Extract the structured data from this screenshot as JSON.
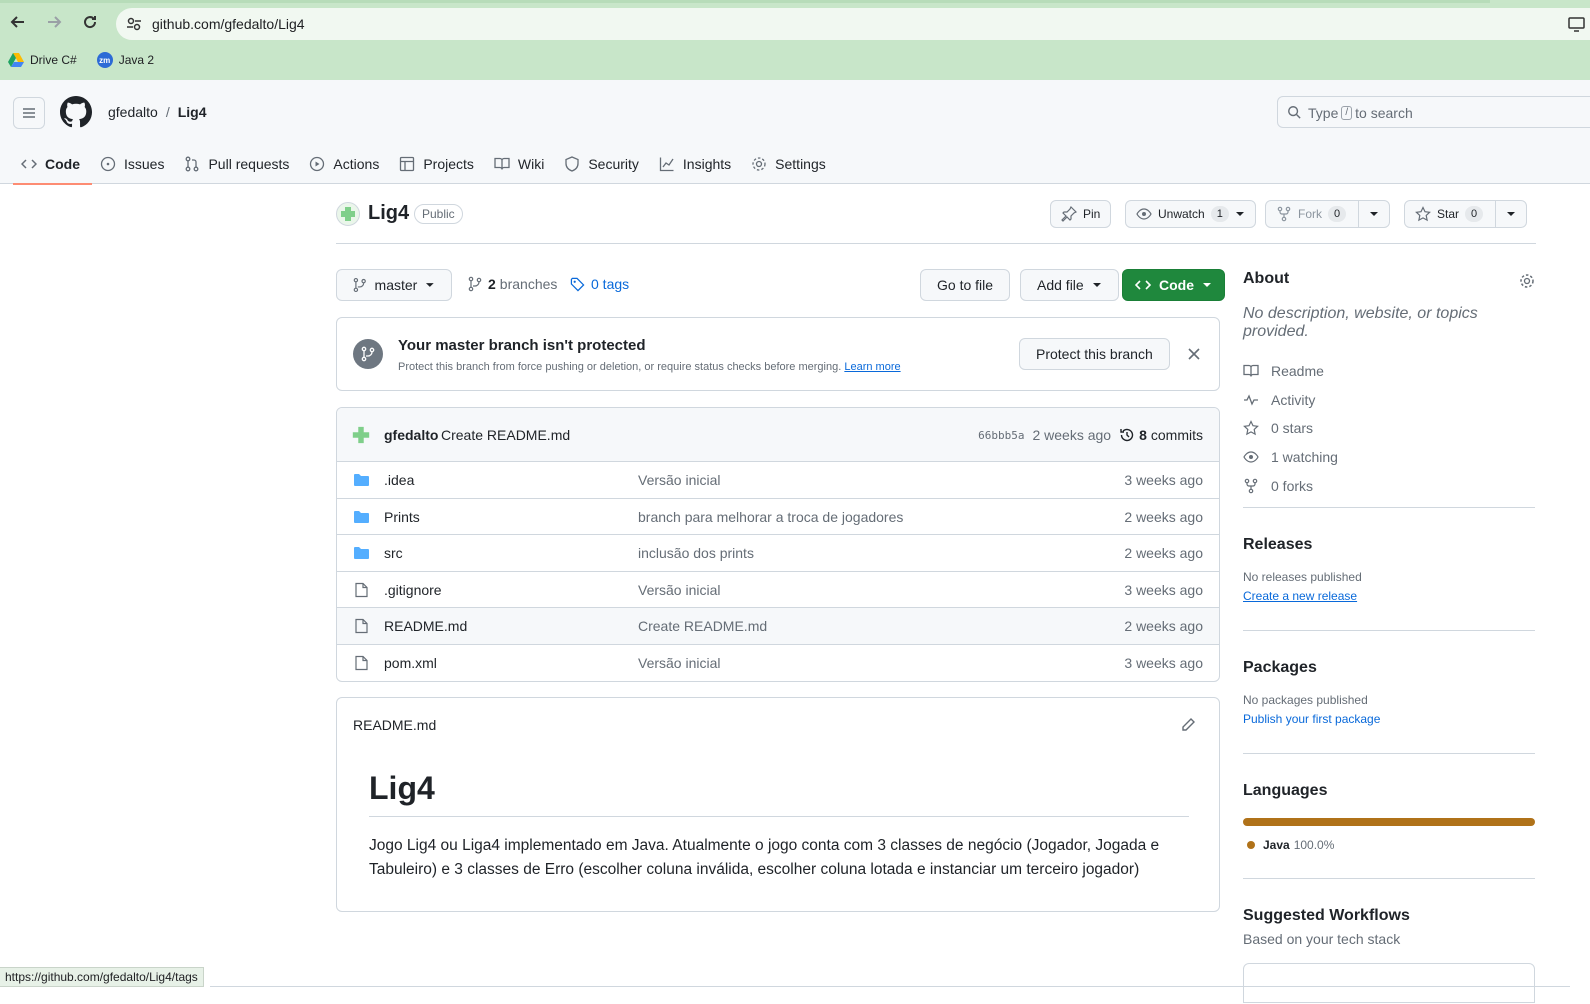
{
  "browser": {
    "url": "github.com/gfedalto/Lig4",
    "bookmarks": [
      {
        "label": "Drive C#"
      },
      {
        "label": "Java 2",
        "badge": "zm"
      }
    ],
    "status_url": "https://github.com/gfedalto/Lig4/tags"
  },
  "header": {
    "owner": "gfedalto",
    "separator": "/",
    "repo": "Lig4",
    "search_placeholder_pre": "Type",
    "search_key": "/",
    "search_placeholder_post": "to search",
    "tabs": [
      {
        "label": "Code",
        "icon": "code-icon",
        "active": true
      },
      {
        "label": "Issues",
        "icon": "issue-icon"
      },
      {
        "label": "Pull requests",
        "icon": "pull-request-icon"
      },
      {
        "label": "Actions",
        "icon": "play-icon"
      },
      {
        "label": "Projects",
        "icon": "table-icon"
      },
      {
        "label": "Wiki",
        "icon": "book-icon"
      },
      {
        "label": "Security",
        "icon": "shield-icon"
      },
      {
        "label": "Insights",
        "icon": "graph-icon"
      },
      {
        "label": "Settings",
        "icon": "gear-icon"
      }
    ]
  },
  "repo": {
    "name": "Lig4",
    "visibility": "Public",
    "pin": "Pin",
    "unwatch": "Unwatch",
    "watch_count": "1",
    "fork": "Fork",
    "fork_count": "0",
    "star": "Star",
    "star_count": "0"
  },
  "controls": {
    "branch": "master",
    "branches_count": "2",
    "branches_label": "branches",
    "tags_label": "0 tags",
    "go_to_file": "Go to file",
    "add_file": "Add file",
    "code": "Code"
  },
  "protect": {
    "title": "Your master branch isn't protected",
    "desc": "Protect this branch from force pushing or deletion, or require status checks before merging.",
    "learn_more": "Learn more",
    "button": "Protect this branch"
  },
  "commit": {
    "author": "gfedalto",
    "message": "Create README.md",
    "sha": "66bbb5a",
    "time": "2 weeks ago",
    "commits_count": "8",
    "commits_label": "commits"
  },
  "files": [
    {
      "name": ".idea",
      "type": "folder",
      "message": "Versão inicial",
      "age": "3 weeks ago"
    },
    {
      "name": "Prints",
      "type": "folder",
      "message": "branch para melhorar a troca de jogadores",
      "age": "2 weeks ago"
    },
    {
      "name": "src",
      "type": "folder",
      "message": "inclusão dos prints",
      "age": "2 weeks ago"
    },
    {
      "name": ".gitignore",
      "type": "file",
      "message": "Versão inicial",
      "age": "3 weeks ago"
    },
    {
      "name": "README.md",
      "type": "file",
      "message": "Create README.md",
      "age": "2 weeks ago"
    },
    {
      "name": "pom.xml",
      "type": "file",
      "message": "Versão inicial",
      "age": "3 weeks ago"
    }
  ],
  "readme": {
    "filename": "README.md",
    "title": "Lig4",
    "body": "Jogo Lig4 ou Liga4 implementado em Java. Atualmente o jogo conta com 3 classes de negócio (Jogador, Jogada e Tabuleiro) e 3 classes de Erro (escolher coluna inválida, escolher coluna lotada e instanciar um terceiro jogador)"
  },
  "sidebar": {
    "about_title": "About",
    "about_desc": "No description, website, or topics provided.",
    "items": [
      {
        "label": "Readme",
        "icon": "book-icon"
      },
      {
        "label": "Activity",
        "icon": "pulse-icon"
      },
      {
        "label": "0 stars",
        "icon": "star-icon"
      },
      {
        "label": "1 watching",
        "icon": "eye-icon"
      },
      {
        "label": "0 forks",
        "icon": "fork-icon"
      }
    ],
    "releases_title": "Releases",
    "releases_none": "No releases published",
    "releases_link": "Create a new release",
    "packages_title": "Packages",
    "packages_none": "No packages published",
    "packages_link": "Publish your first package",
    "languages_title": "Languages",
    "language_name": "Java",
    "language_pct": "100.0%",
    "language_color": "#b07219",
    "workflows_title": "Suggested Workflows",
    "workflows_sub": "Based on your tech stack"
  }
}
